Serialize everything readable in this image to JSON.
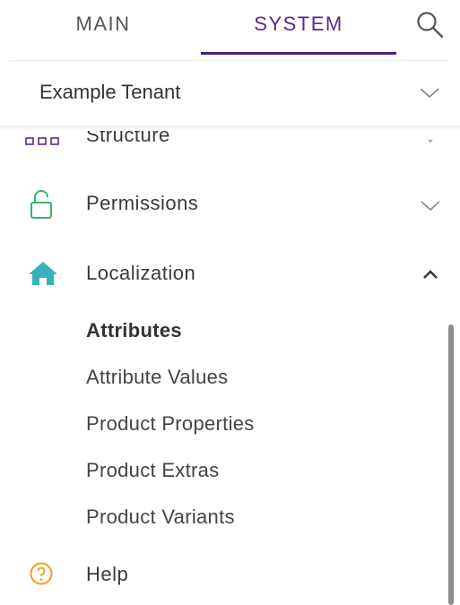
{
  "tabs": {
    "main": "MAIN",
    "system": "SYSTEM"
  },
  "icons": {
    "search": "search-icon",
    "chevron_down": "chevron-down-icon",
    "chevron_up": "chevron-up-icon",
    "structure": "structure-icon",
    "lock": "lock-open-icon",
    "home": "home-icon",
    "help": "help-circle-icon"
  },
  "colors": {
    "accent": "#4a2377",
    "lock": "#3ab26a",
    "home": "#38b2b8",
    "help": "#f0a020"
  },
  "tenant": {
    "label": "Example Tenant"
  },
  "menu": {
    "structure": "Structure",
    "permissions": "Permissions",
    "localization": "Localization",
    "submenu": [
      "Attributes",
      "Attribute Values",
      "Product Properties",
      "Product Extras",
      "Product Variants"
    ],
    "help": "Help"
  }
}
